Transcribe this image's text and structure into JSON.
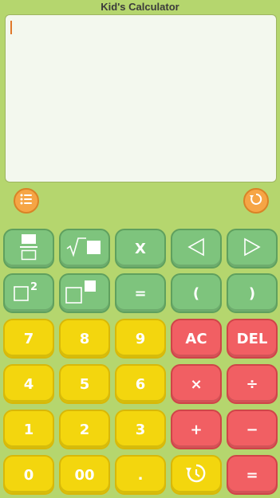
{
  "app": {
    "title": "Kid's Calculator"
  },
  "display": {
    "value": ""
  },
  "toolbar": {
    "menu_icon": "list-icon",
    "reset_icon": "refresh-icon"
  },
  "keys": {
    "row1": [
      "fraction-icon",
      "sqrt-icon",
      "X",
      "left-arrow-icon",
      "right-arrow-icon"
    ],
    "row2": [
      "square-icon",
      "power-icon",
      "=",
      "(",
      ")"
    ],
    "row3": [
      "7",
      "8",
      "9",
      "AC",
      "DEL"
    ],
    "row4": [
      "4",
      "5",
      "6",
      "×",
      "÷"
    ],
    "row5": [
      "1",
      "2",
      "3",
      "+",
      "−"
    ],
    "row6": [
      "0",
      "00",
      ".",
      "history-icon",
      "="
    ]
  }
}
